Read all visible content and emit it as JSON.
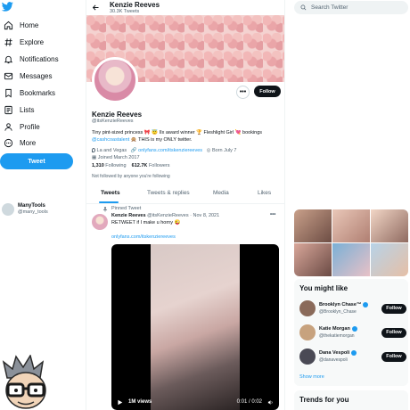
{
  "colors": {
    "accent": "#1d9bf0",
    "dark_button": "#0f1419",
    "muted": "#536471"
  },
  "sidebar": {
    "logo_icon": "twitter-bird-icon",
    "items": [
      {
        "label": "Home",
        "icon": "home-icon"
      },
      {
        "label": "Explore",
        "icon": "hashtag-icon"
      },
      {
        "label": "Notifications",
        "icon": "bell-icon"
      },
      {
        "label": "Messages",
        "icon": "envelope-icon"
      },
      {
        "label": "Bookmarks",
        "icon": "bookmark-icon"
      },
      {
        "label": "Lists",
        "icon": "list-icon"
      },
      {
        "label": "Profile",
        "icon": "person-icon"
      },
      {
        "label": "More",
        "icon": "more-circle-icon"
      }
    ],
    "tweet_button": "Tweet",
    "account": {
      "name": "ManyTools",
      "handle": "@many_tools"
    }
  },
  "header": {
    "name": "Kenzie Reeves",
    "tweet_count": "30.3K Tweets"
  },
  "profile": {
    "follow_button": "Follow",
    "more_button": "•••",
    "name": "Kenzie Reeves",
    "handle": "@itsKenzieReeves",
    "bio_line1": "Tiny pint-sized princess 🎀 😇 IIx award winner 🏆 Fleshlight Girl 💘 bookings",
    "bio_line2_link": "@cashcoastalent",
    "bio_line2_rest": "🙊 THIS is my ONLY twitter.",
    "location": "La and Vegas",
    "website": "onlyfans.com/itskenziereeves",
    "born": "Born July 7",
    "joined": "Joined March 2017",
    "following_count": "1,310",
    "following_label": "Following",
    "followers_count": "612.7K",
    "followers_label": "Followers",
    "followed_by": "Not followed by anyone you're following"
  },
  "tabs": [
    {
      "label": "Tweets",
      "active": true
    },
    {
      "label": "Tweets & replies",
      "active": false
    },
    {
      "label": "Media",
      "active": false
    },
    {
      "label": "Likes",
      "active": false
    }
  ],
  "tweet": {
    "pinned_label": "Pinned Tweet",
    "name": "Kenzie Reeves",
    "handle": "@itsKenzieReeves",
    "date": "· Nov 8, 2021",
    "text": "RETWEET if I make u horny 😜",
    "link": "onlyfans.com/itskenziereeves",
    "views": "1M views",
    "time": "0:01 / 0:02",
    "more": "•••"
  },
  "right": {
    "search_placeholder": "Search Twitter",
    "you_might_like_title": "You might like",
    "suggestions": [
      {
        "name": "Brooklyn Chase™",
        "handle": "@Brooklyn_Chase",
        "button": "Follow",
        "color": "#8a6a5a"
      },
      {
        "name": "Katie Morgan",
        "handle": "@thekatiemorgan",
        "button": "Follow",
        "color": "#c7a27e"
      },
      {
        "name": "Dana Vespoli",
        "handle": "@danavespoli",
        "button": "Follow",
        "color": "#4a4a55"
      }
    ],
    "show_more": "Show more",
    "trends_title": "Trends for you"
  }
}
